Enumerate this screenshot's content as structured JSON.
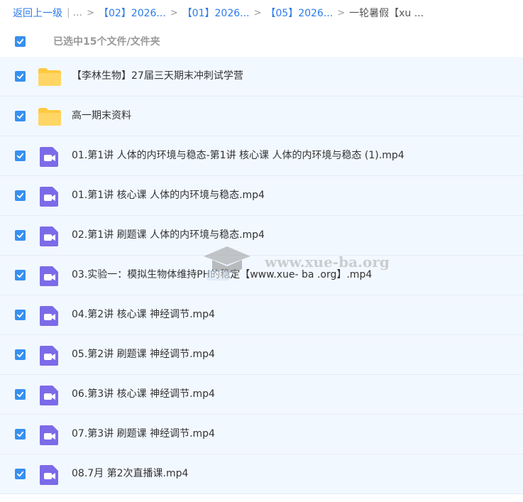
{
  "breadcrumb": {
    "back": "返回上一级",
    "root": "...",
    "items": [
      "【02】2026...",
      "【01】2026...",
      "【05】2026..."
    ],
    "current": "一轮暑假【xu ..."
  },
  "selection": {
    "label": "已选中15个文件/文件夹",
    "checked": true
  },
  "files": [
    {
      "name": "【李林生物】27届三天期末冲刺试学营",
      "type": "folder",
      "checked": true
    },
    {
      "name": "高一期末资料",
      "type": "folder",
      "checked": true
    },
    {
      "name": "01.第1讲 人体的内环境与稳态-第1讲 核心课 人体的内环境与稳态 (1).mp4",
      "type": "video",
      "checked": true
    },
    {
      "name": "01.第1讲 核心课 人体的内环境与稳态.mp4",
      "type": "video",
      "checked": true
    },
    {
      "name": "02.第1讲 刷题课 人体的内环境与稳态.mp4",
      "type": "video",
      "checked": true
    },
    {
      "name": "03.实验一：模拟生物体维持PH的稳定【www.xue- ba .org】.mp4",
      "type": "video",
      "checked": true
    },
    {
      "name": "04.第2讲 核心课 神经调节.mp4",
      "type": "video",
      "checked": true
    },
    {
      "name": "05.第2讲 刷题课 神经调节.mp4",
      "type": "video",
      "checked": true
    },
    {
      "name": "06.第3讲 核心课 神经调节.mp4",
      "type": "video",
      "checked": true
    },
    {
      "name": "07.第3讲 刷题课 神经调节.mp4",
      "type": "video",
      "checked": true
    },
    {
      "name": "08.7月 第2次直播课.mp4",
      "type": "video",
      "checked": true
    }
  ],
  "watermark": {
    "text": "www.xue-ba.org"
  },
  "colors": {
    "accent": "#3790f0",
    "link": "#2b7bea",
    "row_bg": "#f2f8ff",
    "folder": "#ffd050",
    "video": "#7b6be8"
  }
}
